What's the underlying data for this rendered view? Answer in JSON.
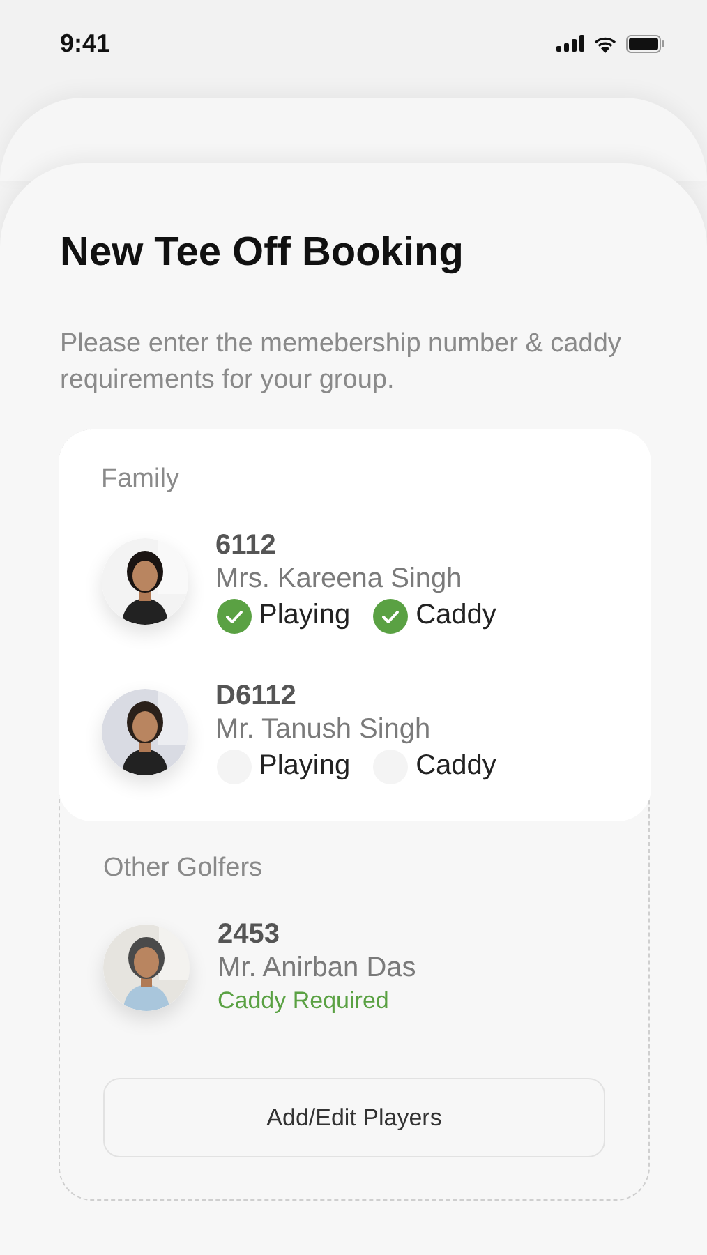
{
  "status_bar": {
    "time": "9:41"
  },
  "title": "New Tee Off Booking",
  "subtitle": "Please enter the memebership number & caddy requirements for your group.",
  "sections": [
    {
      "title": "Family",
      "kind": "card",
      "members": [
        {
          "kind": "toggles",
          "number": "6112",
          "name": "Mrs. Kareena Singh",
          "options": [
            {
              "label": "Playing",
              "checked": true
            },
            {
              "label": "Caddy",
              "checked": true
            }
          ]
        },
        {
          "kind": "toggles",
          "number": "D6112",
          "name": "Mr. Tanush Singh",
          "options": [
            {
              "label": "Playing",
              "checked": false
            },
            {
              "label": "Caddy",
              "checked": false
            }
          ]
        }
      ]
    },
    {
      "title": "Other Golfers",
      "kind": "plain",
      "members": [
        {
          "kind": "status",
          "number": "2453",
          "name": "Mr. Anirban Das",
          "status": "Caddy Required"
        }
      ]
    }
  ],
  "button": "Add/Edit Players"
}
